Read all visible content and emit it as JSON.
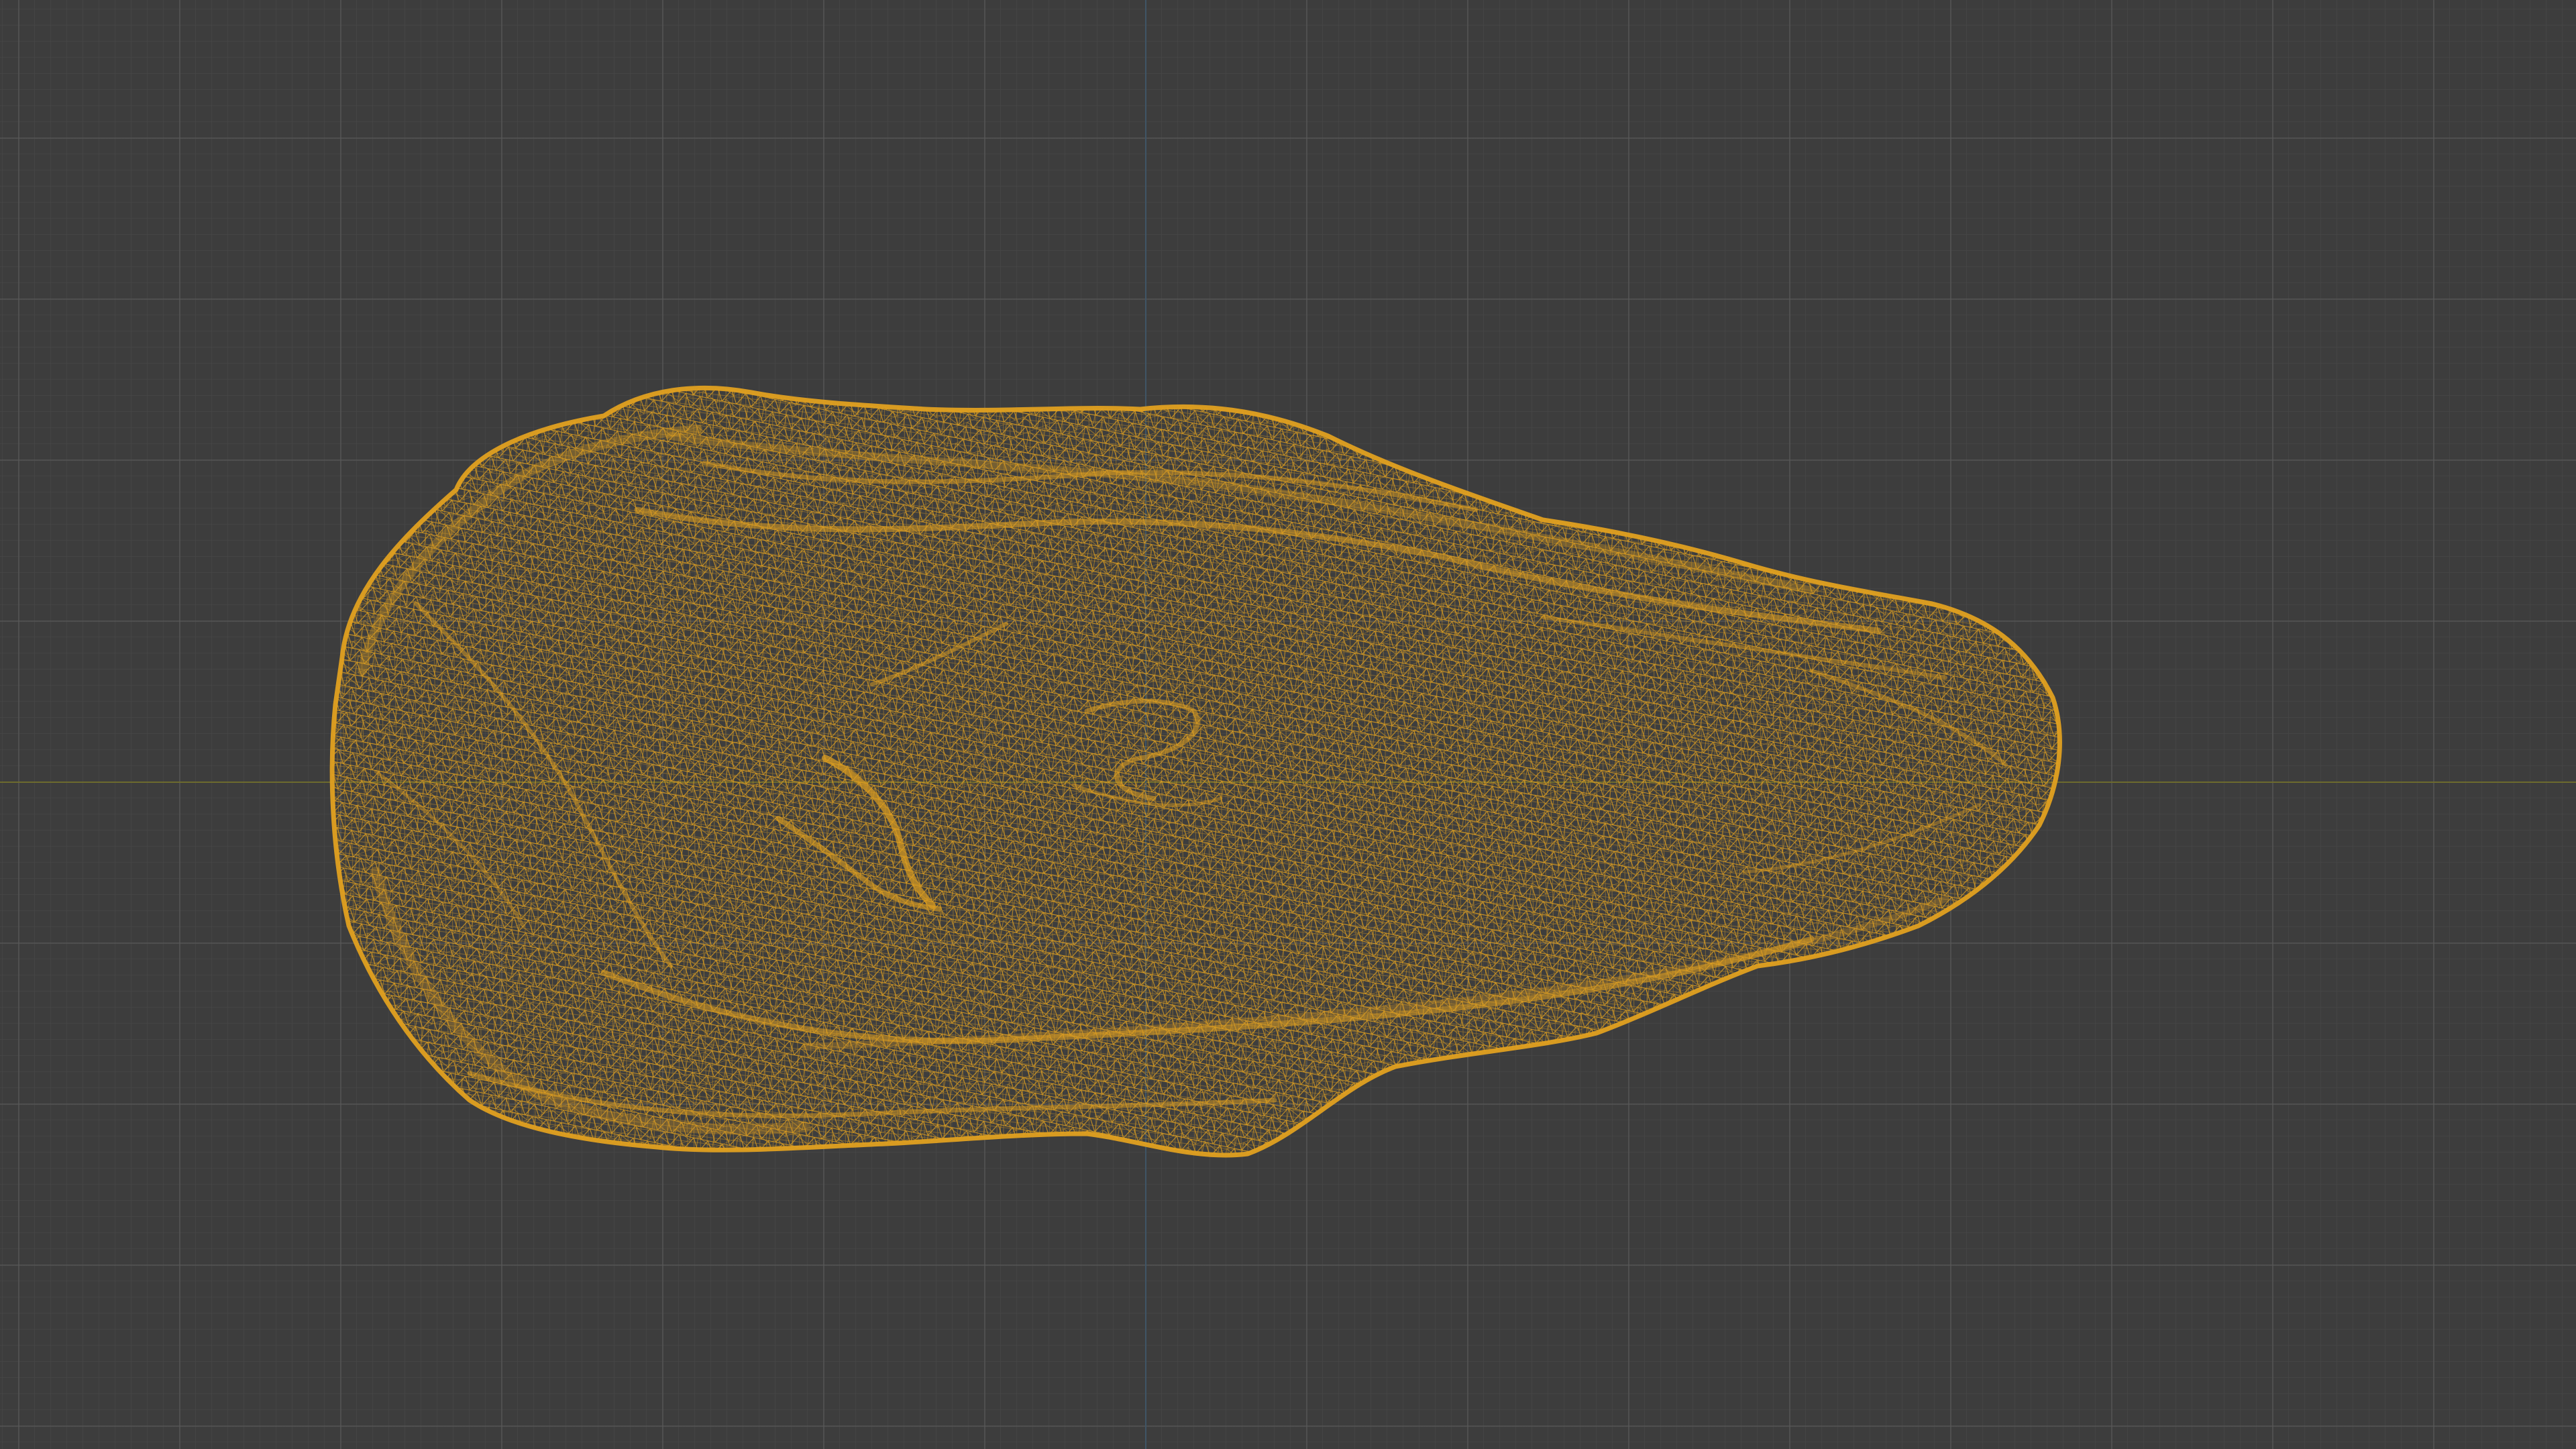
{
  "viewport": {
    "background_color": "#3d3d3d",
    "grid_color": "#5a5a5a",
    "x_axis_color": "#6d6a2e",
    "y_axis_color": "#3f5566"
  },
  "mesh": {
    "display_mode": "wireframe",
    "wire_color": "#e0a020"
  }
}
